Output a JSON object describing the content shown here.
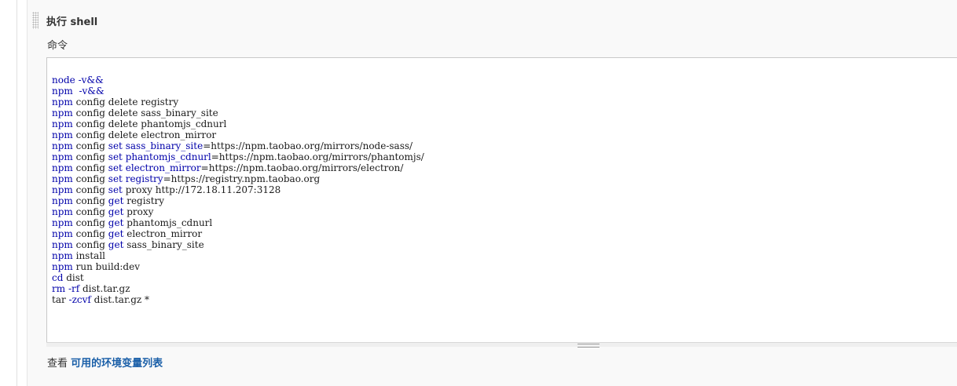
{
  "section": {
    "title": "执行 shell"
  },
  "command": {
    "label": "命令"
  },
  "script_lines": [
    [
      {
        "k": true,
        "t": "node"
      },
      {
        "k": false,
        "t": " "
      },
      {
        "k": true,
        "t": "-v&&"
      }
    ],
    [
      {
        "k": true,
        "t": "npm"
      },
      {
        "k": false,
        "t": "  "
      },
      {
        "k": true,
        "t": "-v&&"
      }
    ],
    [
      {
        "k": true,
        "t": "npm"
      },
      {
        "k": false,
        "t": " config delete registry"
      }
    ],
    [
      {
        "k": true,
        "t": "npm"
      },
      {
        "k": false,
        "t": " config delete sass_binary_site"
      }
    ],
    [
      {
        "k": true,
        "t": "npm"
      },
      {
        "k": false,
        "t": " config delete phantomjs_cdnurl"
      }
    ],
    [
      {
        "k": true,
        "t": "npm"
      },
      {
        "k": false,
        "t": " config delete electron_mirror"
      }
    ],
    [
      {
        "k": true,
        "t": "npm"
      },
      {
        "k": false,
        "t": " config "
      },
      {
        "k": true,
        "t": "set"
      },
      {
        "k": false,
        "t": " "
      },
      {
        "k": true,
        "t": "sass_binary_site"
      },
      {
        "k": false,
        "t": "=https://npm.taobao.org/mirrors/node-sass/"
      }
    ],
    [
      {
        "k": true,
        "t": "npm"
      },
      {
        "k": false,
        "t": " config "
      },
      {
        "k": true,
        "t": "set"
      },
      {
        "k": false,
        "t": " "
      },
      {
        "k": true,
        "t": "phantomjs_cdnurl"
      },
      {
        "k": false,
        "t": "=https://npm.taobao.org/mirrors/phantomjs/"
      }
    ],
    [
      {
        "k": true,
        "t": "npm"
      },
      {
        "k": false,
        "t": " config "
      },
      {
        "k": true,
        "t": "set"
      },
      {
        "k": false,
        "t": " "
      },
      {
        "k": true,
        "t": "electron_mirror"
      },
      {
        "k": false,
        "t": "=https://npm.taobao.org/mirrors/electron/"
      }
    ],
    [
      {
        "k": true,
        "t": "npm"
      },
      {
        "k": false,
        "t": " config "
      },
      {
        "k": true,
        "t": "set"
      },
      {
        "k": false,
        "t": " "
      },
      {
        "k": true,
        "t": "registry"
      },
      {
        "k": false,
        "t": "=https://registry.npm.taobao.org"
      }
    ],
    [
      {
        "k": true,
        "t": "npm"
      },
      {
        "k": false,
        "t": " config "
      },
      {
        "k": true,
        "t": "set"
      },
      {
        "k": false,
        "t": " proxy http://172.18.11.207:3128"
      }
    ],
    [
      {
        "k": true,
        "t": "npm"
      },
      {
        "k": false,
        "t": " config "
      },
      {
        "k": true,
        "t": "get"
      },
      {
        "k": false,
        "t": " registry"
      }
    ],
    [
      {
        "k": true,
        "t": "npm"
      },
      {
        "k": false,
        "t": " config "
      },
      {
        "k": true,
        "t": "get"
      },
      {
        "k": false,
        "t": " proxy"
      }
    ],
    [
      {
        "k": true,
        "t": "npm"
      },
      {
        "k": false,
        "t": " config "
      },
      {
        "k": true,
        "t": "get"
      },
      {
        "k": false,
        "t": " phantomjs_cdnurl"
      }
    ],
    [
      {
        "k": true,
        "t": "npm"
      },
      {
        "k": false,
        "t": " config "
      },
      {
        "k": true,
        "t": "get"
      },
      {
        "k": false,
        "t": " electron_mirror"
      }
    ],
    [
      {
        "k": true,
        "t": "npm"
      },
      {
        "k": false,
        "t": " config "
      },
      {
        "k": true,
        "t": "get"
      },
      {
        "k": false,
        "t": " sass_binary_site"
      }
    ],
    [
      {
        "k": true,
        "t": "npm"
      },
      {
        "k": false,
        "t": " install"
      }
    ],
    [
      {
        "k": true,
        "t": "npm"
      },
      {
        "k": false,
        "t": " run build:dev"
      }
    ],
    [
      {
        "k": true,
        "t": "cd"
      },
      {
        "k": false,
        "t": " dist"
      }
    ],
    [
      {
        "k": true,
        "t": "rm"
      },
      {
        "k": false,
        "t": " "
      },
      {
        "k": true,
        "t": "-rf"
      },
      {
        "k": false,
        "t": " dist.tar.gz"
      }
    ],
    [
      {
        "k": false,
        "t": "tar "
      },
      {
        "k": true,
        "t": "-zcvf"
      },
      {
        "k": false,
        "t": " dist.tar.gz *"
      }
    ]
  ],
  "help": {
    "prefix": "查看 ",
    "link_text": "可用的环境变量列表"
  },
  "colors": {
    "keyword": "#0000aa",
    "text": "#1a1a1a",
    "link": "#1a5fa8"
  }
}
